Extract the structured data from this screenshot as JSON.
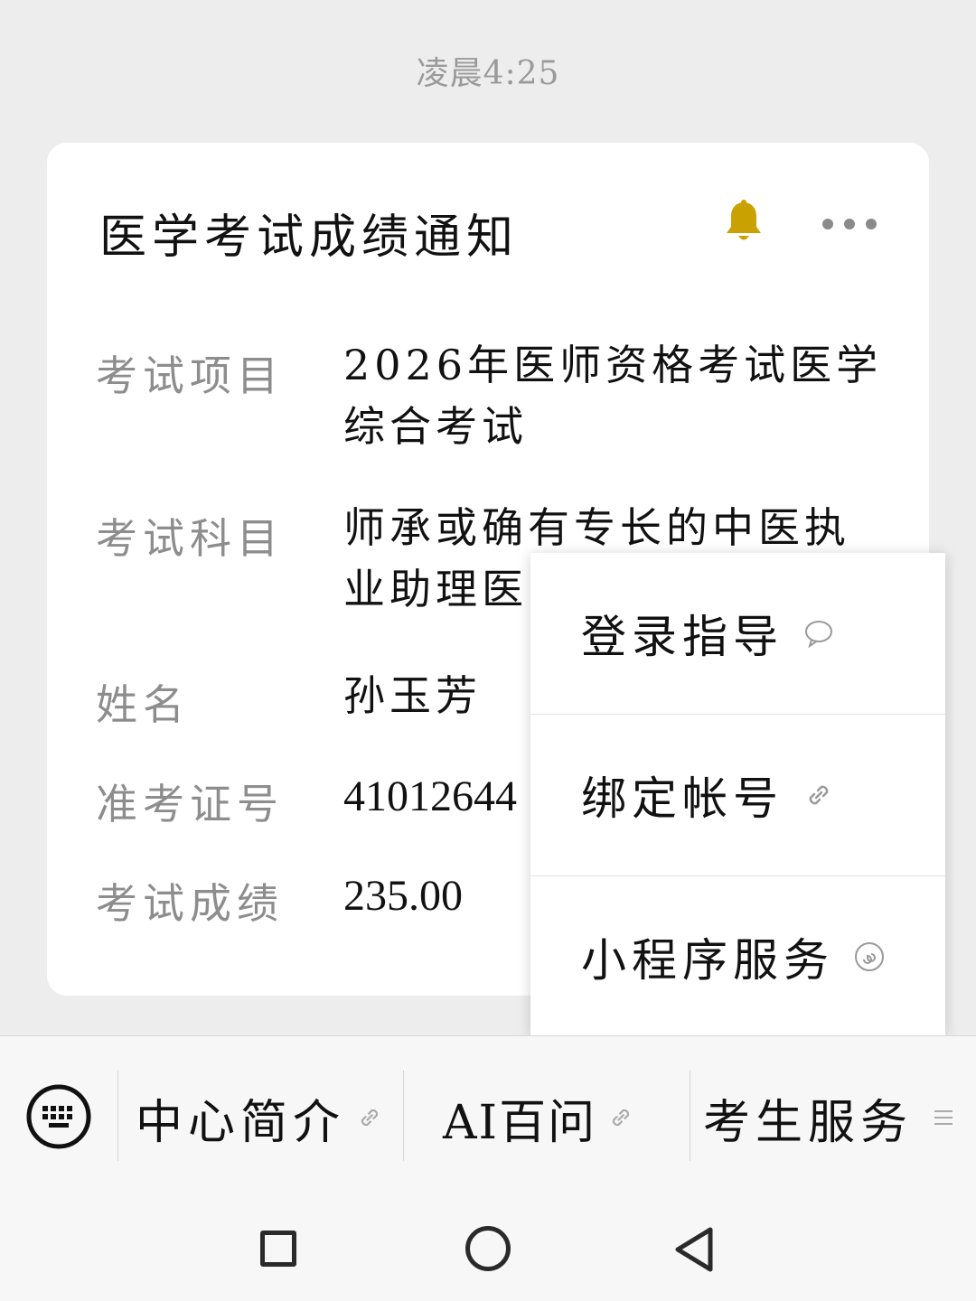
{
  "timestamp": "凌晨4:25",
  "card": {
    "title": "医学考试成绩通知",
    "icons": {
      "bell": "bell-icon",
      "more": "more-dots-icon"
    },
    "rows": [
      {
        "label": "考试项目",
        "value": "2026年医师资格考试医学综合考试"
      },
      {
        "label": "考试科目",
        "value": "师承或确有专长的中医执业助理医"
      },
      {
        "label": "姓名",
        "value": "孙玉芳"
      },
      {
        "label": "准考证号",
        "value": "41012644"
      },
      {
        "label": "考试成绩",
        "value": "235.00"
      }
    ]
  },
  "popup_menu": {
    "items": [
      {
        "label": "登录指导",
        "icon": "chat-bubble-icon"
      },
      {
        "label": "绑定帐号",
        "icon": "link-icon"
      },
      {
        "label": "小程序服务",
        "icon": "mini-program-icon"
      }
    ]
  },
  "bottom_menu": {
    "keyboard_icon": "keyboard-icon",
    "items": [
      {
        "label": "中心简介",
        "icon": "link-icon"
      },
      {
        "label": "AI百问",
        "icon": "link-icon"
      },
      {
        "label": "考生服务",
        "icon": "list-icon"
      }
    ]
  },
  "nav_bar": {
    "icons": [
      "recent-apps-icon",
      "home-icon",
      "back-icon"
    ]
  },
  "colors": {
    "bell": "#c9a100",
    "background": "#ededed",
    "card": "#ffffff",
    "label_gray": "#8d8d8d"
  }
}
